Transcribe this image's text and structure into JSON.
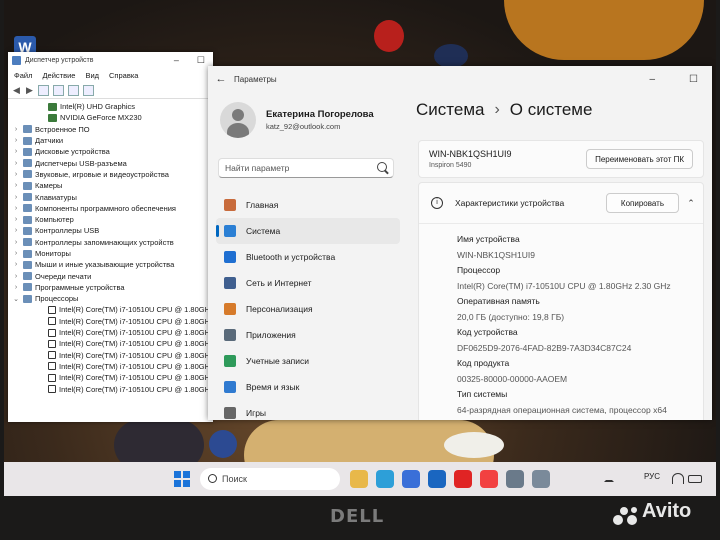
{
  "device_manager": {
    "title": "Диспетчер устройств",
    "menu": [
      "Файл",
      "Действие",
      "Вид",
      "Справка"
    ],
    "tree": [
      {
        "label": "Intel(R) UHD Graphics",
        "kind": "gpu"
      },
      {
        "label": "NVIDIA GeForce MX230",
        "kind": "gpu"
      },
      {
        "label": "Встроенное ПО",
        "kind": "cat"
      },
      {
        "label": "Датчики",
        "kind": "cat"
      },
      {
        "label": "Дисковые устройства",
        "kind": "cat"
      },
      {
        "label": "Диспетчеры USB-разъема",
        "kind": "cat"
      },
      {
        "label": "Звуковые, игровые и видеоустройства",
        "kind": "cat"
      },
      {
        "label": "Камеры",
        "kind": "cat"
      },
      {
        "label": "Клавиатуры",
        "kind": "cat"
      },
      {
        "label": "Компоненты программного обеспечения",
        "kind": "cat"
      },
      {
        "label": "Компьютер",
        "kind": "cat"
      },
      {
        "label": "Контроллеры USB",
        "kind": "cat"
      },
      {
        "label": "Контроллеры запоминающих устройств",
        "kind": "cat"
      },
      {
        "label": "Мониторы",
        "kind": "cat"
      },
      {
        "label": "Мыши и иные указывающие устройства",
        "kind": "cat"
      },
      {
        "label": "Очереди печати",
        "kind": "cat"
      },
      {
        "label": "Программные устройства",
        "kind": "cat"
      },
      {
        "label": "Процессоры",
        "kind": "open"
      },
      {
        "label": "Intel(R) Core(TM) i7-10510U CPU @ 1.80GHz",
        "kind": "cpu"
      },
      {
        "label": "Intel(R) Core(TM) i7-10510U CPU @ 1.80GHz",
        "kind": "cpu"
      },
      {
        "label": "Intel(R) Core(TM) i7-10510U CPU @ 1.80GHz",
        "kind": "cpu"
      },
      {
        "label": "Intel(R) Core(TM) i7-10510U CPU @ 1.80GHz",
        "kind": "cpu"
      },
      {
        "label": "Intel(R) Core(TM) i7-10510U CPU @ 1.80GHz",
        "kind": "cpu"
      },
      {
        "label": "Intel(R) Core(TM) i7-10510U CPU @ 1.80GHz",
        "kind": "cpu"
      },
      {
        "label": "Intel(R) Core(TM) i7-10510U CPU @ 1.80GHz",
        "kind": "cpu"
      },
      {
        "label": "Intel(R) Core(TM) i7-10510U CPU @ 1.80GHz",
        "kind": "cpu"
      }
    ]
  },
  "settings": {
    "window_title": "Параметры",
    "user": {
      "name": "Екатерина Погорелова",
      "email": "katz_92@outlook.com"
    },
    "search_placeholder": "Найти параметр",
    "nav": [
      {
        "label": "Главная",
        "icon": "home-icon",
        "color": "#c86b3c"
      },
      {
        "label": "Система",
        "icon": "system-icon",
        "color": "#2a7fd4",
        "active": true
      },
      {
        "label": "Bluetooth и устройства",
        "icon": "bluetooth-icon",
        "color": "#1f6fd1"
      },
      {
        "label": "Сеть и Интернет",
        "icon": "network-icon",
        "color": "#3f5f8f"
      },
      {
        "label": "Персонализация",
        "icon": "brush-icon",
        "color": "#d67a2a"
      },
      {
        "label": "Приложения",
        "icon": "apps-icon",
        "color": "#5a6a7a"
      },
      {
        "label": "Учетные записи",
        "icon": "accounts-icon",
        "color": "#2e9a5a"
      },
      {
        "label": "Время и язык",
        "icon": "time-language-icon",
        "color": "#2f7ad0"
      },
      {
        "label": "Игры",
        "icon": "games-icon",
        "color": "#666666"
      }
    ],
    "breadcrumb": {
      "parent": "Система",
      "separator": "›",
      "current": "О системе"
    },
    "device": {
      "name": "WIN-NBK1QSH1UI9",
      "model": "Inspiron 5490",
      "rename_label": "Переименовать этот ПК"
    },
    "specs": {
      "header": "Характеристики устройства",
      "copy_label": "Копировать",
      "items": [
        {
          "label": "Имя устройства",
          "value": "WIN-NBK1QSH1UI9"
        },
        {
          "label": "Процессор",
          "value": "Intel(R) Core(TM) i7-10510U CPU @ 1.80GHz   2.30 GHz"
        },
        {
          "label": "Оперативная память",
          "value": "20,0 ГБ (доступно: 19,8 ГБ)"
        },
        {
          "label": "Код устройства",
          "value": "DF0625D9-2076-4FAD-82B9-7A3D34C87C24"
        },
        {
          "label": "Код продукта",
          "value": "00325-80000-00000-AAOEM"
        },
        {
          "label": "Тип системы",
          "value": "64-разрядная операционная система, процессор x64"
        }
      ]
    }
  },
  "taskbar": {
    "search_label": "Поиск",
    "language": "РУС",
    "apps": [
      {
        "name": "file-explorer-icon",
        "color": "#e8b84a"
      },
      {
        "name": "edge-icon",
        "color": "#2d9fd8"
      },
      {
        "name": "store-icon",
        "color": "#3a6fd8"
      },
      {
        "name": "outlook-icon",
        "color": "#1a66c0"
      },
      {
        "name": "yandex-icon",
        "color": "#e02424"
      },
      {
        "name": "yandex-browser-icon",
        "color": "#f24141"
      },
      {
        "name": "settings-app-icon",
        "color": "#6a7a8a"
      },
      {
        "name": "device-manager-app-icon",
        "color": "#7a8a9a"
      }
    ]
  },
  "branding": {
    "laptop": "DELL",
    "watermark": "Avito"
  }
}
